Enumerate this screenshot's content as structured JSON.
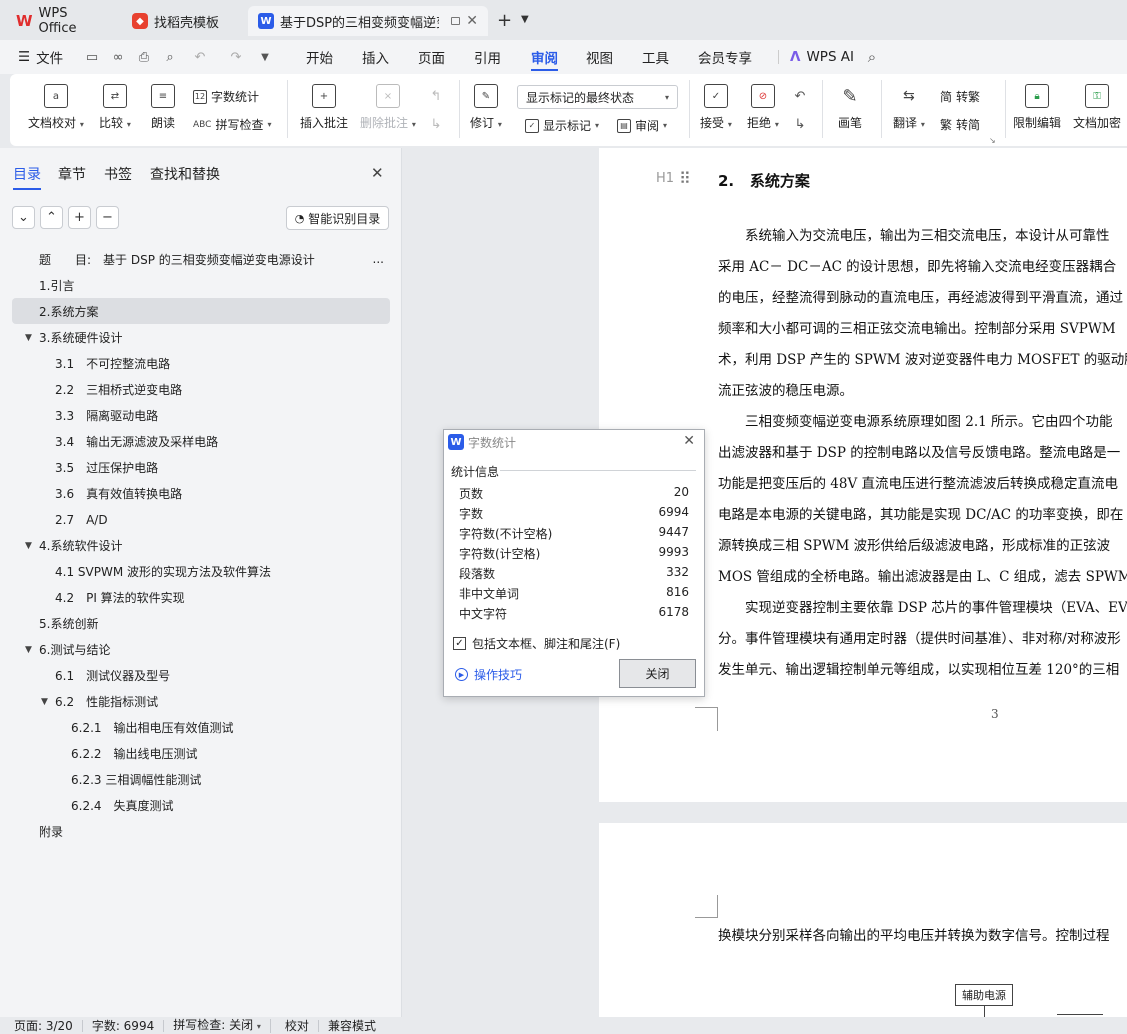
{
  "tabs": [
    {
      "label": "WPS Office",
      "icon": "wps-logo-icon"
    },
    {
      "label": "找稻壳模板",
      "icon": "template-logo-icon"
    },
    {
      "label": "基于DSP的三相变频变幅逆变电",
      "icon": "writer-doc-icon"
    }
  ],
  "menu": {
    "file": "文件",
    "tabs": [
      "开始",
      "插入",
      "页面",
      "引用",
      "审阅",
      "视图",
      "工具",
      "会员专享"
    ],
    "active": "审阅",
    "ai": "WPS AI"
  },
  "ribbon": {
    "proofread": "文档校对",
    "compare": "比较",
    "read_aloud": "朗读",
    "word_count": "字数统计",
    "spell_check": "拼写检查",
    "insert_comment": "插入批注",
    "delete_comment": "删除批注",
    "track_changes": "修订",
    "markup_view": "显示标记的最终状态",
    "show_markup": "显示标记",
    "reviewing_pane": "审阅",
    "accept": "接受",
    "reject": "拒绝",
    "ink": "画笔",
    "translate": "翻译",
    "to_traditional": "转繁",
    "to_simplified": "转简",
    "restrict_editing": "限制编辑",
    "encrypt": "文档加密"
  },
  "panel": {
    "tabs": [
      "目录",
      "章节",
      "书签",
      "查找和替换"
    ],
    "smart_toc": "智能识别目录",
    "toc": [
      {
        "label": "题　　目:　基于 DSP 的三相变频变幅逆变电源设计"
      },
      {
        "label": "1.引言"
      },
      {
        "label": "2.系统方案"
      },
      {
        "label": "3.系统硬件设计"
      },
      {
        "label": "3.1　不可控整流电路"
      },
      {
        "label": "2.2　三相桥式逆变电路"
      },
      {
        "label": "3.3　隔离驱动电路"
      },
      {
        "label": "3.4　输出无源滤波及采样电路"
      },
      {
        "label": "3.5　过压保护电路"
      },
      {
        "label": "3.6　真有效值转换电路"
      },
      {
        "label": "2.7　A/D"
      },
      {
        "label": "4.系统软件设计"
      },
      {
        "label": "4.1 SVPWM 波形的实现方法及软件算法"
      },
      {
        "label": "4.2　PI 算法的软件实现"
      },
      {
        "label": "5.系统创新"
      },
      {
        "label": "6.测试与结论"
      },
      {
        "label": "6.1　测试仪器及型号"
      },
      {
        "label": "6.2　性能指标测试"
      },
      {
        "label": "6.2.1　输出相电压有效值测试"
      },
      {
        "label": "6.2.2　输出线电压测试"
      },
      {
        "label": "6.2.3 三相调幅性能测试"
      },
      {
        "label": "6.2.4　失真度测试"
      },
      {
        "label": "附录"
      }
    ],
    "more": "..."
  },
  "document": {
    "heading_marker": "H1",
    "heading_num": "2.",
    "heading": "系统方案",
    "lines": [
      "　　系统输入为交流电压，输出为三相交流电压，本设计从可靠性",
      "采用 AC－ DC－AC 的设计思想，即先将输入交流电经变压器耦合",
      "的电压，经整流得到脉动的直流电压，再经滤波得到平滑直流，通过",
      "频率和大小都可调的三相正弦交流电输出。控制部分采用 SVPWM",
      "术，利用 DSP 产生的 SPWM 波对逆变器件电力 MOSFET 的驱动脉",
      "流正弦波的稳压电源。",
      "　　三相变频变幅逆变电源系统原理如图 2.1 所示。它由四个功能",
      "出滤波器和基于 DSP 的控制电路以及信号反馈电路。整流电路是一",
      "功能是把变压后的 48V 直流电压进行整流滤波后转换成稳定直流电",
      "电路是本电源的关键电路，其功能是实现 DC/AC 的功率变换，即在",
      "源转换成三相 SPWM 波形供给后级滤波电路，形成标准的正弦波",
      "MOS 管组成的全桥电路。输出滤波器是由 L、C 组成，滤去 SPWM",
      "　　实现逆变器控制主要依靠 DSP 芯片的事件管理模块（EVA、EV",
      "分。事件管理模块有通用定时器（提供时间基准）、非对称/对称波形",
      "发生单元、输出逻辑控制单元等组成，以实现相位互差 120°的三相"
    ],
    "page_number": "3",
    "next_page_line": "换模块分别采样各向输出的平均电压并转换为数字信号。控制过程",
    "diagram_label": "辅助电源"
  },
  "dialog": {
    "title": "字数统计",
    "section": "统计信息",
    "stats": [
      {
        "label": "页数",
        "value": "20"
      },
      {
        "label": "字数",
        "value": "6994"
      },
      {
        "label": "字符数(不计空格)",
        "value": "9447"
      },
      {
        "label": "字符数(计空格)",
        "value": "9993"
      },
      {
        "label": "段落数",
        "value": "332"
      },
      {
        "label": "非中文单词",
        "value": "816"
      },
      {
        "label": "中文字符",
        "value": "6178"
      }
    ],
    "checkbox_label": "包括文本框、脚注和尾注(F)",
    "checkbox_checked": true,
    "tips": "操作技巧",
    "close": "关闭"
  },
  "status": {
    "page": "页面: 3/20",
    "words": "字数: 6994",
    "spell": "拼写检查: 关闭",
    "proof": "校对",
    "compat": "兼容模式"
  },
  "colors": {
    "accent": "#2b5ce8",
    "brand_red": "#e02d2d"
  }
}
